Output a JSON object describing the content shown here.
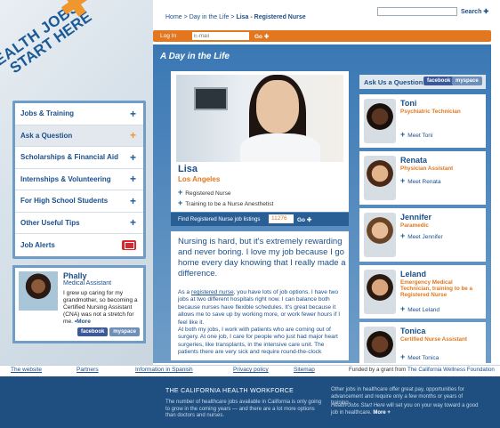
{
  "logo": {
    "line1": "HEALTH JOBS",
    "line2": "START HERE"
  },
  "breadcrumb": {
    "home": "Home",
    "sep": ">",
    "section": "Day in the Life",
    "current": "Lisa - Registered Nurse"
  },
  "search": {
    "label": "Search",
    "placeholder": ""
  },
  "login": {
    "label": "Log In",
    "email_placeholder": "E-mail",
    "go": "Go"
  },
  "nav": {
    "items": [
      {
        "label": "Jobs & Training",
        "icon": "plus"
      },
      {
        "label": "Ask a Question",
        "icon": "plus"
      },
      {
        "label": "Scholarships & Financial Aid",
        "icon": "plus"
      },
      {
        "label": "Internships & Volunteering",
        "icon": "plus"
      },
      {
        "label": "For High School Students",
        "icon": "plus"
      },
      {
        "label": "Other Useful Tips",
        "icon": "plus"
      },
      {
        "label": "Job Alerts",
        "icon": "mail-icon"
      }
    ]
  },
  "phally": {
    "name": "Phally",
    "role": "Medical Assistant",
    "quote": "I grew up caring for my grandmother, so becoming a Certified Nursing Assistant (CNA) was not a stretch for me.",
    "more": "•More",
    "facebook": "facebook",
    "myspace": "myspace"
  },
  "main": {
    "title": "A Day in the Life",
    "profile": {
      "name": "Lisa",
      "location": "Los Angeles",
      "role1": "Registered Nurse",
      "role2": "Training to be a Nurse Anesthetist"
    },
    "find": {
      "label": "Find Registered Nurse job listings",
      "zip": "11276",
      "go": "Go"
    },
    "story": {
      "lead": "Nursing is hard, but it's extremely rewarding and never boring. I love my job because I go home every day knowing that I really made a difference.",
      "p1_prefix": "As a ",
      "p1_link": "registered nurse",
      "p1_rest": ", you have lots of job options. I have two jobs at two different hospitals right now. I can balance both because nurses have flexible schedules. It's great because it allows me to save up by working more, or work fewer hours if I feel like it.",
      "p2": "At both my jobs, I work with patients who are coming out of surgery. At one job, I care for people who just had major heart surgeries, like transplants, in the intensive care unit. The patients there are very sick and require round-the-clock"
    }
  },
  "ask": {
    "title": "Ask Us a Question",
    "facebook": "facebook",
    "myspace": "myspace",
    "people": [
      {
        "name": "Toni",
        "role": "Psychiatric Technician",
        "meet": "Meet Toni",
        "skin": "#5a3522",
        "hair": "#1a110c"
      },
      {
        "name": "Renata",
        "role": "Physician Assistant",
        "meet": "Meet Renata",
        "skin": "#e2b48c",
        "hair": "#4a2a16"
      },
      {
        "name": "Jennifer",
        "role": "Paramedic",
        "meet": "Meet Jennifer",
        "skin": "#e6bd98",
        "hair": "#6a4426"
      },
      {
        "name": "Leland",
        "role": "Emergency Medical Technician, training to be a Registered Nurse",
        "meet": "Meet Leland",
        "skin": "#d9a57e",
        "hair": "#2a1a10"
      },
      {
        "name": "Tonica",
        "role": "Certified Nurse Assistant",
        "meet": "Meet Tonica",
        "skin": "#6a3e26",
        "hair": "#1c120c"
      }
    ]
  },
  "footer": {
    "links": [
      "The website",
      "Partners",
      "Information in Spanish",
      "Privacy policy",
      "Sitemap"
    ],
    "funded_prefix": "Funded by a grant from ",
    "funded_link": "The California Wellness Foundation",
    "heading": "THE CALIFORNIA HEALTH WORKFORCE",
    "para": "The number of healthcare jobs available in California is only going to grow in the coming years — and there are a lot more options than doctors and nurses.",
    "right1": "Other jobs in healthcare offer great pay, opportunities for advancement and require only a few months or years of training.",
    "right2_italic": "Health Jobs Start Here",
    "right2_rest": " will set you on your way toward a good job in healthcare.",
    "right2_more": "More +"
  },
  "colors": {
    "brand_blue": "#1b4f8a",
    "orange": "#e2771f",
    "footer": "#1e4f80"
  }
}
